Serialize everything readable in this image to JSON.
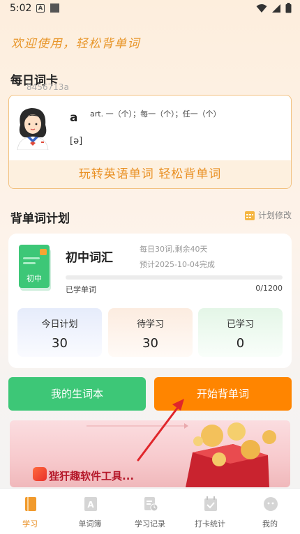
{
  "status_bar": {
    "time": "5:02",
    "a_icon_text": "A"
  },
  "welcome_text": "欢迎使用，轻松背单词",
  "daily_card": {
    "title": "每日词卡",
    "user_id": "8456713a",
    "word": "a",
    "meaning": "art. 一（个）；每一（个）；任一（个）",
    "phonetic": "[ə]",
    "banner": "玩转英语单词 轻松背单词"
  },
  "plan": {
    "title": "背单词计划",
    "edit_label": "计划修改",
    "book_label": "初中",
    "name": "初中词汇",
    "info_daily": "每日30词,剩余40天",
    "info_expected": "预计2025-10-04完成",
    "learned_label": "已学单词",
    "learned_count": "0/1200",
    "progress": 0,
    "stats": [
      {
        "label": "今日计划",
        "value": "30"
      },
      {
        "label": "待学习",
        "value": "30"
      },
      {
        "label": "已学习",
        "value": "0"
      }
    ]
  },
  "buttons": {
    "vocab_book": "我的生词本",
    "start": "开始背单词"
  },
  "ad": {
    "text": "狴犴趣软件工具..."
  },
  "nav": [
    {
      "label": "学习",
      "icon": "study-book-icon",
      "active": true
    },
    {
      "label": "单词簿",
      "icon": "word-book-icon",
      "active": false
    },
    {
      "label": "学习记录",
      "icon": "study-record-icon",
      "active": false
    },
    {
      "label": "打卡统计",
      "icon": "checkin-calendar-icon",
      "active": false
    },
    {
      "label": "我的",
      "icon": "profile-face-icon",
      "active": false
    }
  ],
  "colors": {
    "accent_orange": "#ff8500",
    "green": "#3dc777",
    "text_orange": "#e98f22"
  }
}
